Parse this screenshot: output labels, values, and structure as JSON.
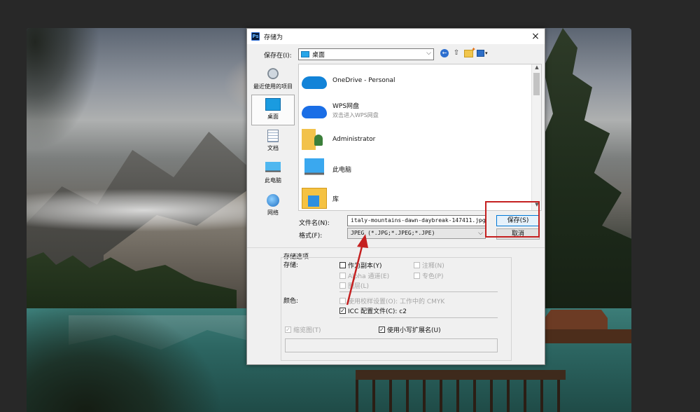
{
  "dialog": {
    "title": "存储为",
    "app_icon": "Ps",
    "close_icon": "×"
  },
  "savein": {
    "label": "保存在(I):",
    "value": "桌面"
  },
  "toolbar": {
    "back_icon": "back-arrow-icon",
    "up_icon": "up-folder-icon",
    "new_folder_icon": "new-folder-icon",
    "view_icon": "view-menu-icon"
  },
  "places": [
    {
      "label": "最近使用的项目",
      "icon": "recent-icon"
    },
    {
      "label": "桌面",
      "icon": "desktop-icon",
      "selected": true
    },
    {
      "label": "文档",
      "icon": "documents-icon"
    },
    {
      "label": "此电脑",
      "icon": "this-pc-icon"
    },
    {
      "label": "网络",
      "icon": "network-icon"
    }
  ],
  "files": [
    {
      "name": "OneDrive - Personal",
      "sub": ""
    },
    {
      "name": "WPS网盘",
      "sub": "双击进入WPS网盘"
    },
    {
      "name": "Administrator",
      "sub": ""
    },
    {
      "name": "此电脑",
      "sub": ""
    },
    {
      "name": "库",
      "sub": ""
    }
  ],
  "filename": {
    "label": "文件名(N):",
    "value": "italy-mountains-dawn-daybreak-147411.jpg"
  },
  "format": {
    "label": "格式(F):",
    "value": "JPEG (*.JPG;*.JPEG;*.JPE)"
  },
  "buttons": {
    "save": "保存(S)",
    "cancel": "取消"
  },
  "options": {
    "group_label": "存储选项",
    "save_label": "存储:",
    "as_copy": "作为副本(Y)",
    "notes": "注释(N)",
    "alpha": "Alpha 通道(E)",
    "spot": "专色(P)",
    "layers": "图层(L)",
    "color_label": "颜色:",
    "proof": "使用校样设置(O): 工作中的 CMYK",
    "icc": "ICC 配置文件(C): c2",
    "thumbnail": "缩览图(T)",
    "lowercase": "使用小写扩展名(U)"
  },
  "colors": {
    "accent": "#0078d7",
    "highlight": "#c52020"
  }
}
